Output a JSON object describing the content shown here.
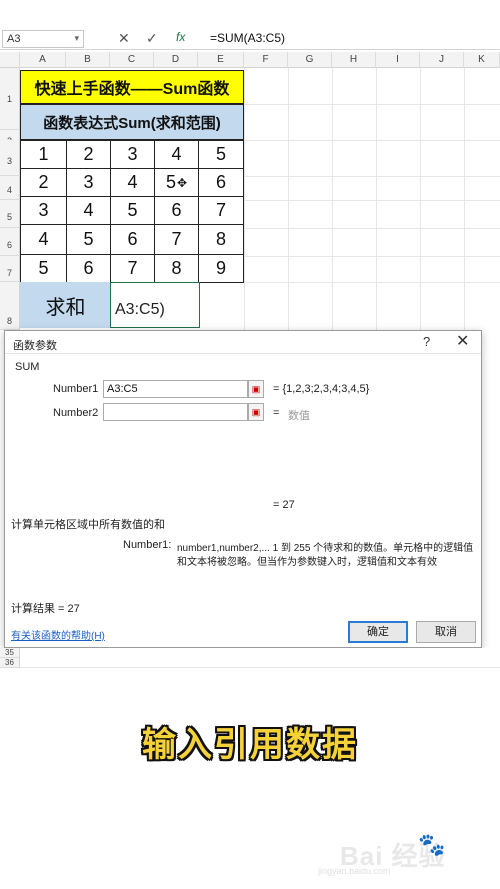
{
  "formula_bar": {
    "name_box": "A3",
    "fx_icon": "fx",
    "formula": "=SUM(A3:C5)"
  },
  "columns": [
    "A",
    "B",
    "C",
    "D",
    "E",
    "F",
    "G",
    "H",
    "I",
    "J",
    "K"
  ],
  "rows": [
    "1",
    "2",
    "3",
    "4",
    "5",
    "6",
    "7",
    "8"
  ],
  "sheet": {
    "title": "快速上手函数——Sum函数",
    "subtitle": "函数表达式Sum(求和范围)",
    "data": [
      [
        "1",
        "2",
        "3",
        "4",
        "5"
      ],
      [
        "2",
        "3",
        "4",
        "5",
        "6"
      ],
      [
        "3",
        "4",
        "5",
        "6",
        "7"
      ],
      [
        "4",
        "5",
        "6",
        "7",
        "8"
      ],
      [
        "5",
        "6",
        "7",
        "8",
        "9"
      ]
    ],
    "sum_label": "求和",
    "editing_value": "A3:C5)"
  },
  "dialog": {
    "title": "函数参数",
    "help_icon": "?",
    "close_icon": "✕",
    "function_name": "SUM",
    "number1_label": "Number1",
    "number1_value": "A3:C5",
    "number1_result": "= {1,2,3;2,3,4;3,4,5}",
    "number2_label": "Number2",
    "number2_result_eq": "=",
    "number2_result": "数值",
    "total_result": "= 27",
    "description": "计算单元格区域中所有数值的和",
    "param_name": "Number1:",
    "param_desc_line1": "number1,number2,... 1 到 255 个待求和的数值。单元格中的逻辑值",
    "param_desc_line2": "和文本将被忽略。但当作为参数键入时，逻辑值和文本有效",
    "calc_result": "计算结果 =   27",
    "help_link": "有关该函数的帮助(H)",
    "ok": "确定",
    "cancel": "取消"
  },
  "below_rows": [
    "35",
    "36"
  ],
  "caption": "输入引用数据",
  "watermark": {
    "brand": "Bai  经验",
    "sub": "jingyan.baidu.com"
  },
  "colors": {
    "title_fill": "#ffff00",
    "subtitle_fill": "#c3d9ee",
    "sum_fill": "#c3d9ee",
    "selection": "#217346",
    "caption": "#f5d13a"
  }
}
